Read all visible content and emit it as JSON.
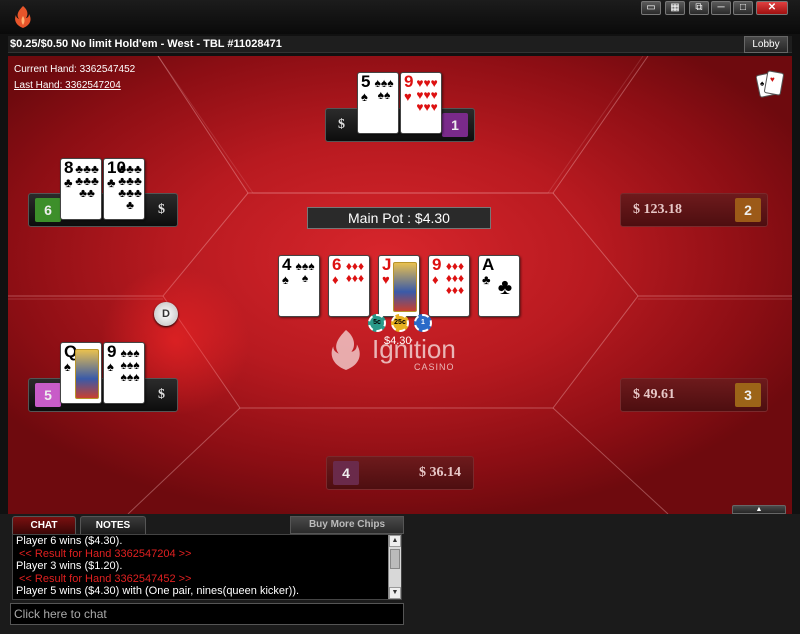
{
  "window": {
    "controls": [
      "▭",
      "▦",
      "⧉",
      "─",
      "□",
      "✕"
    ]
  },
  "infobar": {
    "title": "$0.25/$0.50 No limit Hold'em - West - TBL #11028471",
    "lobby_label": "Lobby"
  },
  "hand_info": {
    "current": "Current Hand: 3362547452",
    "last": "Last Hand: 3362547204"
  },
  "pot": {
    "main_label": "Main Pot : $4.30",
    "amount": "$4.30",
    "chips": [
      "5c",
      "25c",
      "1"
    ]
  },
  "dealer_label": "D",
  "brand": {
    "name": "Ignition",
    "sub": "CASINO"
  },
  "seats": [
    {
      "num": "1",
      "stack": "$"
    },
    {
      "num": "6",
      "stack": "$"
    },
    {
      "num": "5",
      "stack": "$"
    },
    {
      "num": "2",
      "stack": "$ 123.18"
    },
    {
      "num": "3",
      "stack": "$ 49.61"
    },
    {
      "num": "4",
      "stack": "$ 36.14"
    }
  ],
  "cards": {
    "seat1": [
      {
        "rank": "5",
        "suit": "♠",
        "color": "black"
      },
      {
        "rank": "9",
        "suit": "♥",
        "color": "red"
      }
    ],
    "seat6": [
      {
        "rank": "8",
        "suit": "♣",
        "color": "black"
      },
      {
        "rank": "10",
        "suit": "♣",
        "color": "black"
      }
    ],
    "seat5": [
      {
        "rank": "Q",
        "suit": "♠",
        "color": "black"
      },
      {
        "rank": "9",
        "suit": "♠",
        "color": "black"
      }
    ],
    "board": [
      {
        "rank": "4",
        "suit": "♠",
        "color": "black"
      },
      {
        "rank": "6",
        "suit": "♦",
        "color": "red"
      },
      {
        "rank": "J",
        "suit": "♥",
        "color": "red"
      },
      {
        "rank": "9",
        "suit": "♦",
        "color": "red"
      },
      {
        "rank": "A",
        "suit": "♣",
        "color": "black"
      }
    ]
  },
  "tabs": {
    "chat": "CHAT",
    "notes": "NOTES",
    "buy_chips": "Buy More Chips"
  },
  "chat": {
    "lines": [
      "Player 6 wins ($4.30).",
      "<< Result for Hand 3362547204 >>",
      "Player 3 wins ($1.20).",
      "<< Result for Hand 3362547452 >>",
      "Player 5 wins ($4.30) with (One pair, nines(queen kicker))."
    ],
    "input_placeholder": "Click here to chat",
    "scroll_up": "▲",
    "scroll_down": "▼"
  },
  "expand_label": "▲",
  "colors": {
    "felt": "#b81a20",
    "seat6": "#3d8f2a",
    "seat1": "#7a2a8a",
    "seat5": "#c85cc8",
    "seat2": "#9c5a18",
    "seat3": "#9c6418",
    "seat4": "#6a2a4a"
  }
}
